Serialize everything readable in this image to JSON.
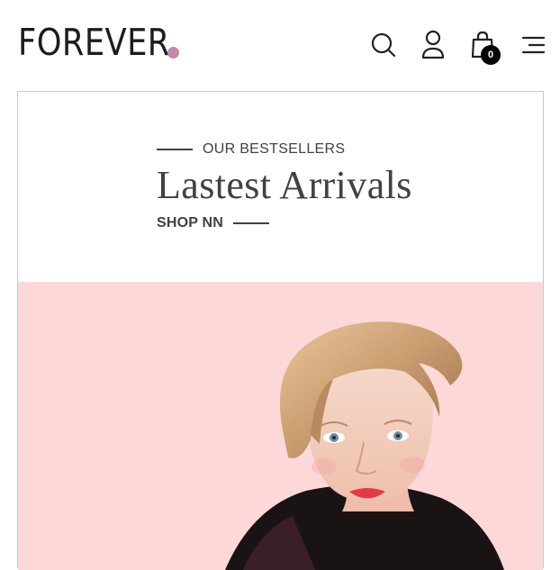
{
  "brand": {
    "name": "FOREVER",
    "dot_color": "#c588a8"
  },
  "header": {
    "icons": [
      "search-icon",
      "user-icon",
      "cart-icon",
      "menu-icon"
    ],
    "cart_count": "0"
  },
  "hero": {
    "eyebrow": "OUR BESTSELLERS",
    "title": "Lastest Arrivals",
    "cta": "SHOP NN",
    "image_bg": "#fdd8d8"
  }
}
